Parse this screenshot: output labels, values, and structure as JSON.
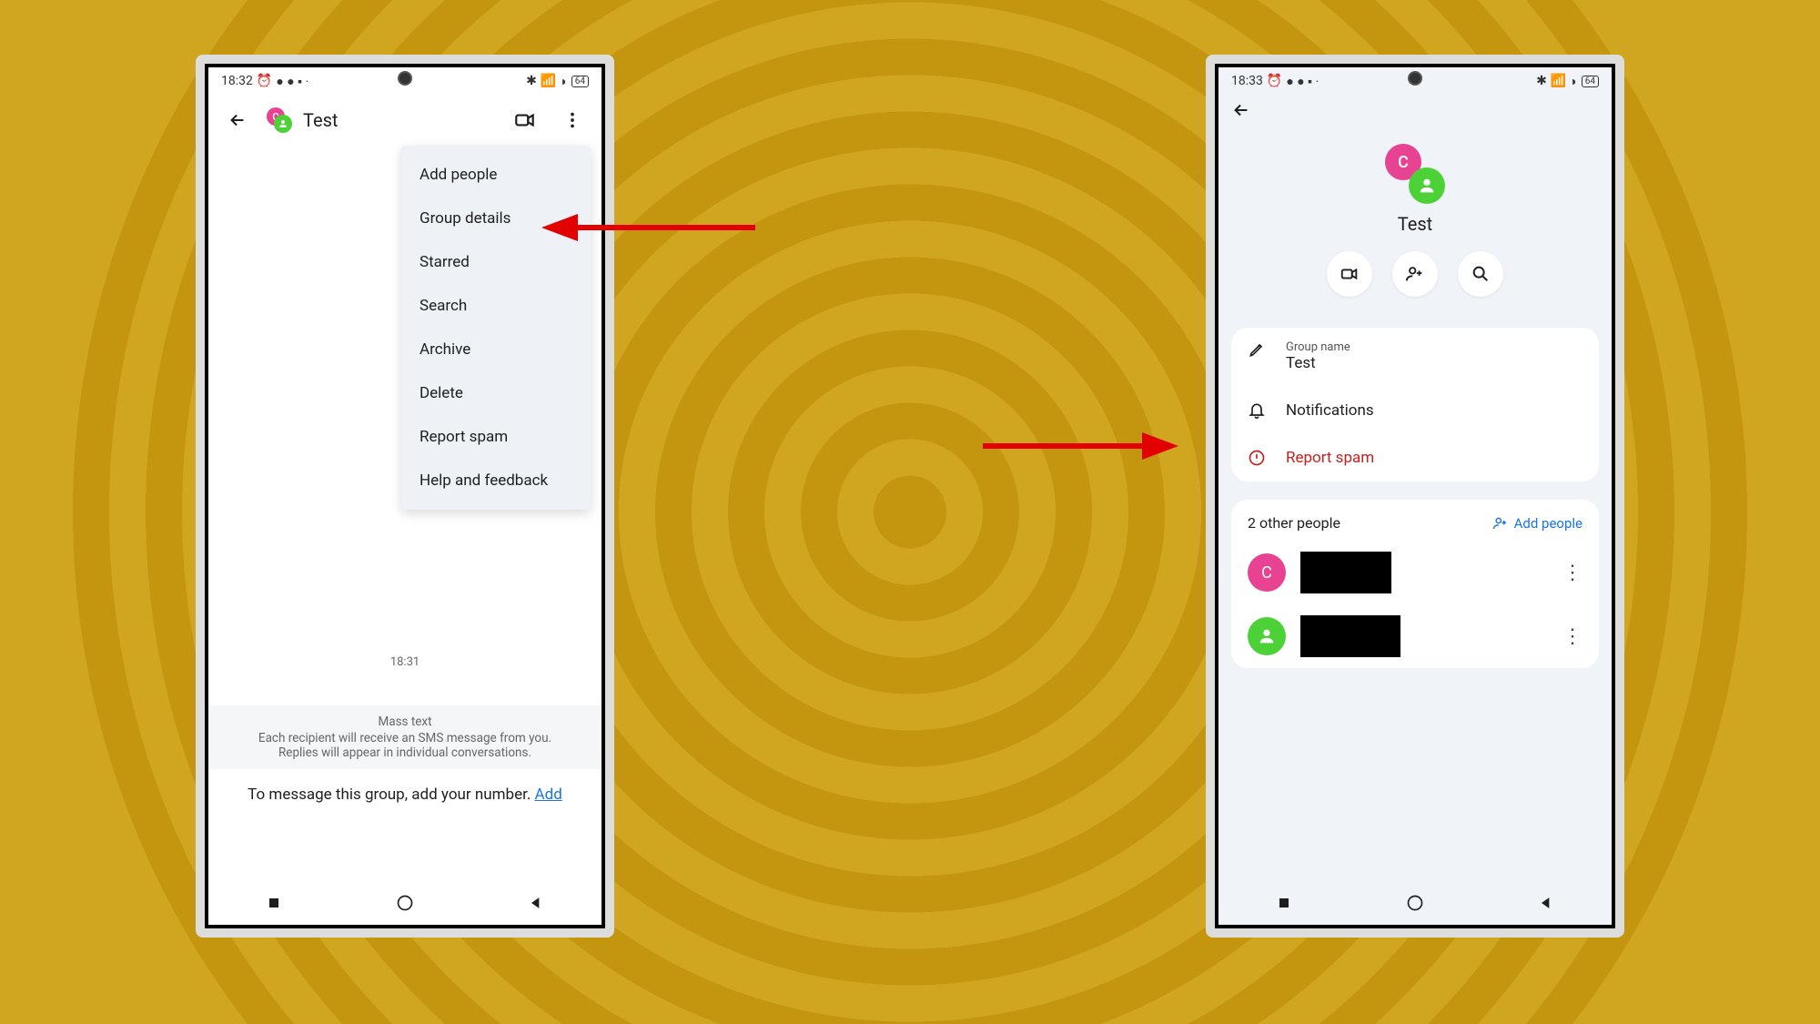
{
  "left": {
    "status": {
      "time": "18:32",
      "battery": "64"
    },
    "chat_title": "Test",
    "menu": [
      "Add people",
      "Group details",
      "Starred",
      "Search",
      "Archive",
      "Delete",
      "Report spam",
      "Help and feedback"
    ],
    "timestamp": "18:31",
    "banner_title": "Mass text",
    "banner_line1": "Each recipient will receive an SMS message from you.",
    "banner_line2": "Replies will appear in individual conversations.",
    "add_number_text": "To message this group, add your number. ",
    "add_number_link": "Add"
  },
  "right": {
    "status": {
      "time": "18:33",
      "battery": "64"
    },
    "title": "Test",
    "group_name_label": "Group name",
    "group_name_value": "Test",
    "notifications": "Notifications",
    "report_spam": "Report spam",
    "people_count": "2 other people",
    "add_people": "Add people"
  },
  "avatar_letter": "C"
}
